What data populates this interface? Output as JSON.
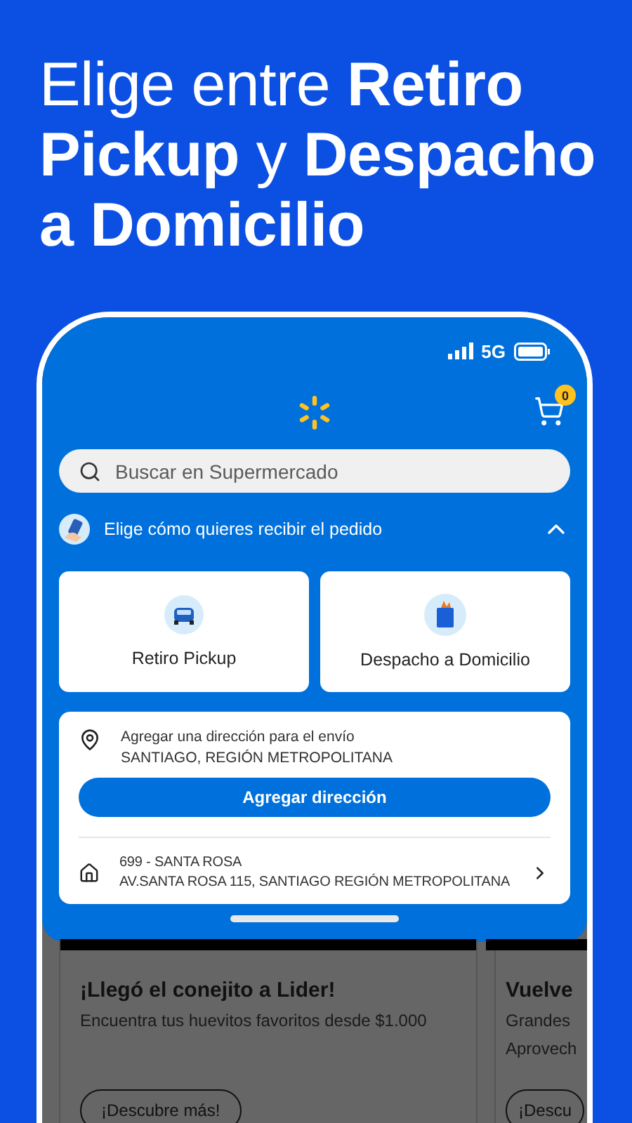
{
  "headline": "Elige entre **Retiro Pickup** y **Despacho a Domicilio**",
  "status_bar": {
    "network": "5G"
  },
  "cart": {
    "count": "0"
  },
  "search": {
    "placeholder": "Buscar en Supermercado"
  },
  "delivery_picker": {
    "title": "Elige cómo quieres recibir el pedido",
    "expanded": true,
    "options": [
      {
        "label": "Retiro Pickup",
        "kind": "pickup"
      },
      {
        "label": "Despacho a Domicilio",
        "kind": "delivery"
      }
    ]
  },
  "address_card": {
    "prompt": "Agregar una dirección para el envío",
    "region": "SANTIAGO, REGIÓN METROPOLITANA",
    "button": "Agregar dirección",
    "saved_address": {
      "name": "699 - SANTA ROSA",
      "address": "AV.SANTA ROSA 115, SANTIAGO REGIÓN METROPOLITANA"
    }
  },
  "promos": [
    {
      "title": "¡Llegó el conejito a Lider!",
      "lines": [
        "Encuentra tus huevitos favoritos desde $1.000"
      ],
      "button": "¡Descubre más!"
    },
    {
      "title": "Vuelve",
      "lines": [
        "Grandes",
        "Aprovech"
      ],
      "button": "¡Descu"
    }
  ]
}
